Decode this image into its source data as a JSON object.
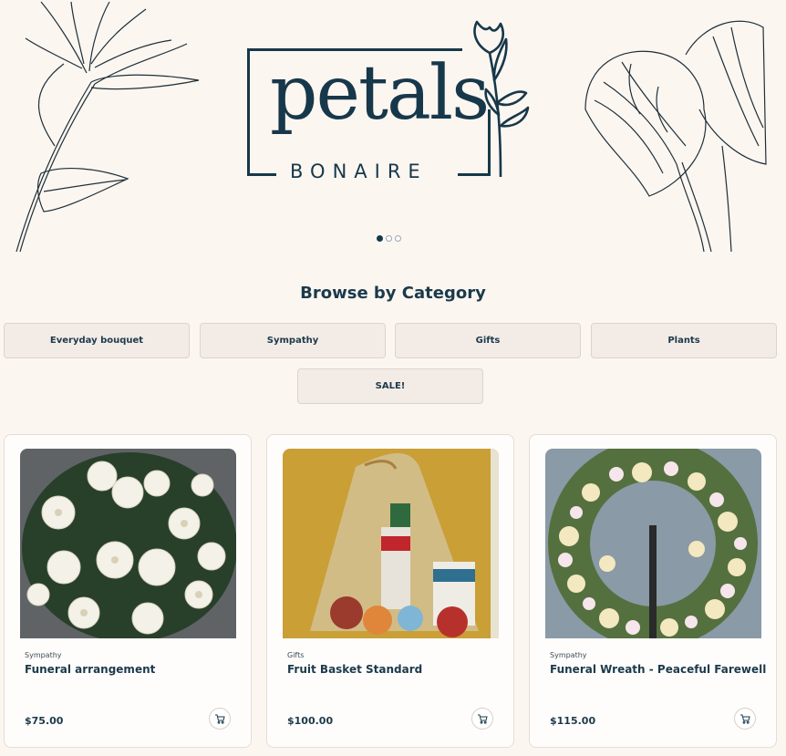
{
  "brand": {
    "word": "petals",
    "sub": "BONAIRE"
  },
  "carousel": {
    "slides": 3,
    "active": 0
  },
  "browse": {
    "title": "Browse by Category",
    "categories": [
      "Everyday bouquet",
      "Sympathy",
      "Gifts",
      "Plants",
      "SALE!"
    ]
  },
  "products": [
    {
      "category": "Sympathy",
      "name": "Funeral arrangement",
      "price": "$75.00",
      "image_icon": "white-flower-arrangement"
    },
    {
      "category": "Gifts",
      "name": "Fruit Basket Standard",
      "price": "$100.00",
      "image_icon": "fruit-basket"
    },
    {
      "category": "Sympathy",
      "name": "Funeral Wreath - Peaceful Farewell",
      "price": "$115.00",
      "image_icon": "flower-wreath"
    }
  ],
  "colors": {
    "brand_navy": "#17384a",
    "background": "#fcf6f1",
    "category_button": "#f3ebe6"
  }
}
